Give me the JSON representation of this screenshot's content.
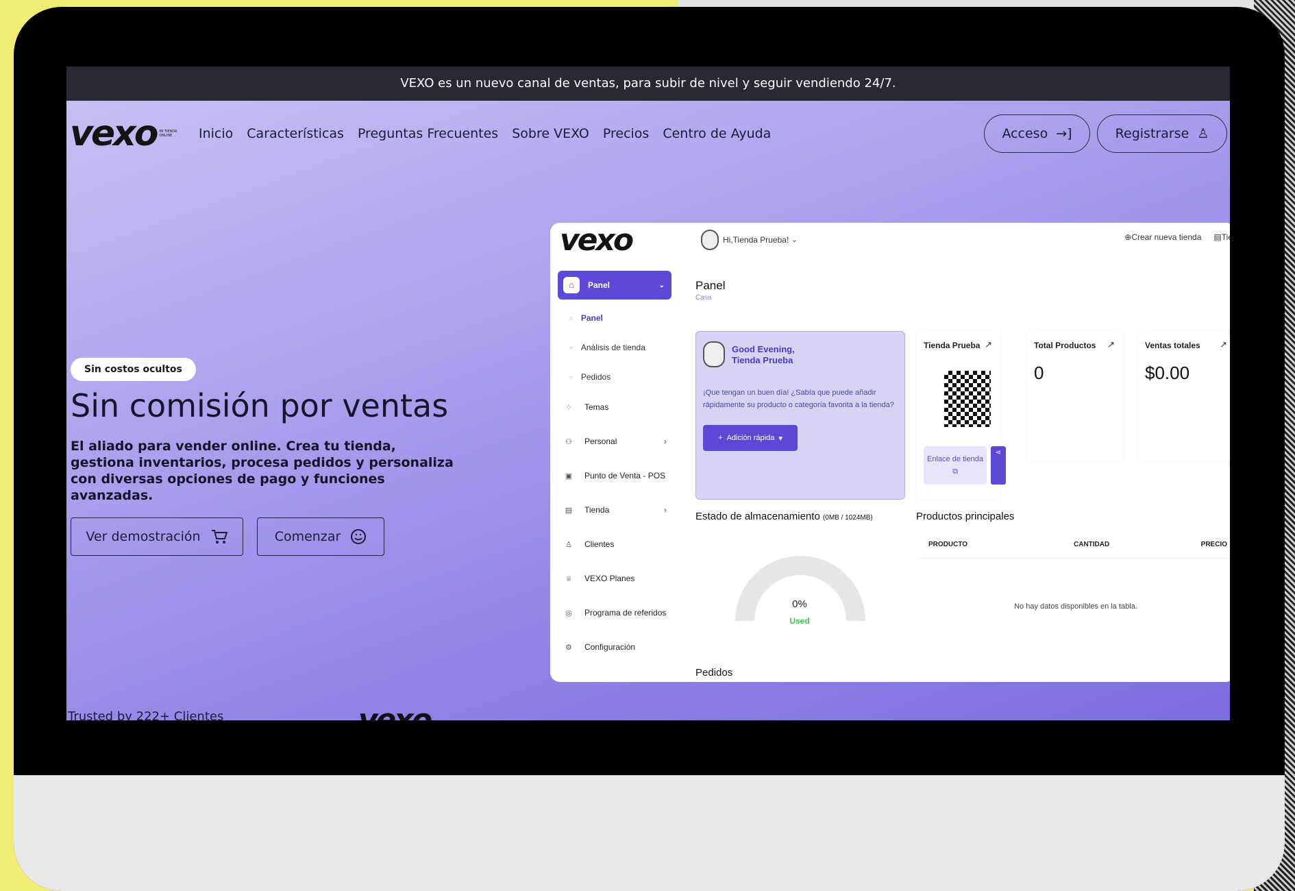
{
  "announcement": "VEXO es un nuevo canal de ventas, para subir de nivel y seguir vendiendo 24/7.",
  "brand": {
    "logo": "vexo",
    "logo_sub": "MI TIENDA ONLINE"
  },
  "nav": {
    "links": [
      "Inicio",
      "Características",
      "Preguntas Frecuentes",
      "Sobre VEXO",
      "Precios",
      "Centro de Ayuda"
    ],
    "login": "Acceso",
    "register": "Registrarse"
  },
  "hero": {
    "badge": "Sin costos ocultos",
    "title": "Sin comisión por ventas",
    "description": "El aliado para vender online. Crea tu tienda, gestiona inventarios, procesa pedidos y personaliza con diversas opciones de pago y funciones avanzadas.",
    "demo_button": "Ver demostración",
    "start_button": "Comenzar"
  },
  "trusted": "Trusted by 222+ Clientes",
  "dashboard": {
    "greeting_user": "Hi,Tienda Prueba!",
    "create_store": "Crear nueva tienda",
    "store_short": "Tier",
    "sidebar": {
      "panel": "Panel",
      "sub_items": [
        "Panel",
        "Análisis de tienda",
        "Pedidos"
      ],
      "items": [
        {
          "label": "Temas",
          "icon": "grid-icon",
          "chevron": false
        },
        {
          "label": "Personal",
          "icon": "users-icon",
          "chevron": true
        },
        {
          "label": "Punto de Venta - POS",
          "icon": "pos-icon",
          "chevron": false
        },
        {
          "label": "Tienda",
          "icon": "store-icon",
          "chevron": true
        },
        {
          "label": "Clientes",
          "icon": "user-icon",
          "chevron": false
        },
        {
          "label": "VEXO Planes",
          "icon": "trophy-icon",
          "chevron": false
        },
        {
          "label": "Programa de referidos",
          "icon": "referral-icon",
          "chevron": false
        },
        {
          "label": "Configuración",
          "icon": "gear-icon",
          "chevron": false
        }
      ]
    },
    "page_title": "Panel",
    "breadcrumb": "Casa",
    "welcome": {
      "greeting": "Good Evening,",
      "name": "Tienda Prueba",
      "message": "¡Que tengan un buen día! ¿Sabía que puede añadir rápidamente su producto o categoría favorita a la tienda?",
      "quick_add": "Adición rápida"
    },
    "cards": {
      "store": {
        "title": "Tienda Prueba",
        "link_label": "Enlace de tienda"
      },
      "products": {
        "title": "Total Productos",
        "value": "0"
      },
      "sales": {
        "title": "Ventas totales",
        "value": "$0.00"
      }
    },
    "storage": {
      "title": "Estado de almacenamiento",
      "detail": "(0MB / 1024MB)",
      "percent": "0%",
      "used_label": "Used"
    },
    "top_products": {
      "title": "Productos principales",
      "columns": [
        "PRODUCTO",
        "CANTIDAD",
        "PRECIO"
      ],
      "empty": "No hay datos disponibles en la tabla."
    },
    "orders_title": "Pedidos"
  },
  "colors": {
    "accent": "#5b4ad6",
    "announce_bg": "#252a33",
    "used_green": "#3cc54a"
  }
}
